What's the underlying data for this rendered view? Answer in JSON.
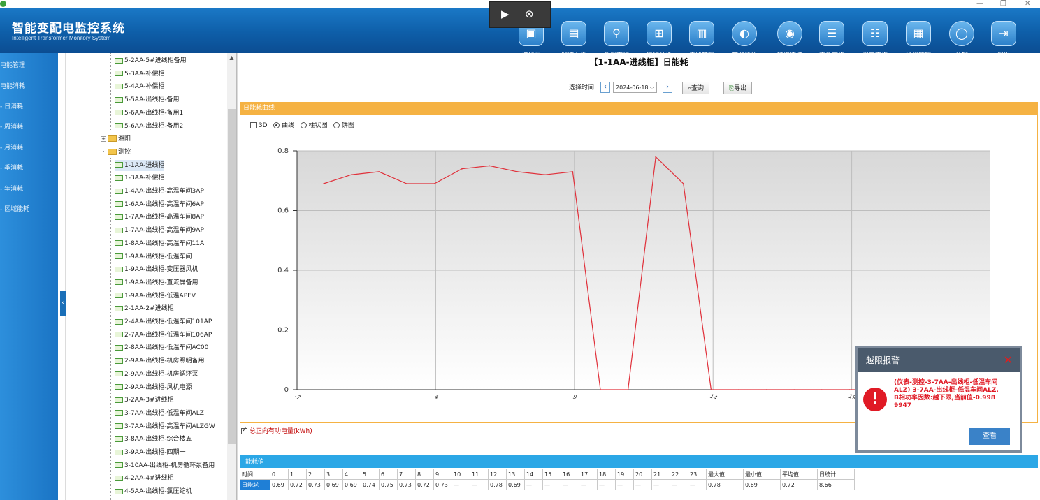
{
  "app": {
    "title": "智能变配电监控系统",
    "subtitle": "Intelligent Transformer Monitory System"
  },
  "window_controls": [
    "—",
    "❐",
    "✕"
  ],
  "nav": [
    {
      "label": "接线图",
      "icon": "monitor-icon"
    },
    {
      "label": "监控看板",
      "icon": "dashboard-icon"
    },
    {
      "label": "数据查询",
      "icon": "satellite-icon"
    },
    {
      "label": "运行分析",
      "icon": "network-icon"
    },
    {
      "label": "电能管理",
      "icon": "computer-icon"
    },
    {
      "label": "节能评估",
      "icon": "leaf-icon"
    },
    {
      "label": "环境监控",
      "icon": "camera-icon"
    },
    {
      "label": "事件查询",
      "icon": "list-icon"
    },
    {
      "label": "报表查询",
      "icon": "report-icon"
    },
    {
      "label": "通讯管理",
      "icon": "comm-icon"
    },
    {
      "label": "注销",
      "icon": "user-icon"
    },
    {
      "label": "退出",
      "icon": "exit-icon"
    }
  ],
  "left_menu": [
    "电能管理",
    "电能消耗",
    "- 日消耗",
    "- 周消耗",
    "- 月消耗",
    "- 季消耗",
    "- 年消耗",
    "- 区域能耗"
  ],
  "tree": [
    {
      "label": "5-2AA-5#进线柜备用",
      "type": "leaf"
    },
    {
      "label": "5-3AA-补偿柜",
      "type": "leaf"
    },
    {
      "label": "5-4AA-补偿柜",
      "type": "leaf"
    },
    {
      "label": "5-5AA-出线柜-备用",
      "type": "leaf"
    },
    {
      "label": "5-6AA-出线柜-备用1",
      "type": "leaf"
    },
    {
      "label": "5-6AA-出线柜-备用2",
      "type": "leaf"
    },
    {
      "label": "湘阳",
      "type": "folder",
      "exp": "+"
    },
    {
      "label": "测控",
      "type": "folder",
      "exp": "-"
    },
    {
      "label": "1-1AA-进线柜",
      "type": "leaf",
      "selected": true
    },
    {
      "label": "1-3AA-补偿柜",
      "type": "leaf"
    },
    {
      "label": "1-4AA-出线柜-高温车间3AP",
      "type": "leaf"
    },
    {
      "label": "1-6AA-出线柜-高温车间6AP",
      "type": "leaf"
    },
    {
      "label": "1-7AA-出线柜-高温车间8AP",
      "type": "leaf"
    },
    {
      "label": "1-7AA-出线柜-高温车间9AP",
      "type": "leaf"
    },
    {
      "label": "1-8AA-出线柜-高温车间11A",
      "type": "leaf"
    },
    {
      "label": "1-9AA-出线柜-低温车间",
      "type": "leaf"
    },
    {
      "label": "1-9AA-出线柜-变压器风机",
      "type": "leaf"
    },
    {
      "label": "1-9AA-出线柜-直流屏备用",
      "type": "leaf"
    },
    {
      "label": "1-9AA-出线柜-低温APEV",
      "type": "leaf"
    },
    {
      "label": "2-1AA-2#进线柜",
      "type": "leaf"
    },
    {
      "label": "2-4AA-出线柜-低温车间101AP",
      "type": "leaf"
    },
    {
      "label": "2-7AA-出线柜-低温车间106AP",
      "type": "leaf"
    },
    {
      "label": "2-8AA-出线柜-低温车间AC00",
      "type": "leaf"
    },
    {
      "label": "2-9AA-出线柜-机房照明备用",
      "type": "leaf"
    },
    {
      "label": "2-9AA-出线柜-机房循环泵",
      "type": "leaf"
    },
    {
      "label": "2-9AA-出线柜-风机电源",
      "type": "leaf"
    },
    {
      "label": "3-2AA-3#进线柜",
      "type": "leaf"
    },
    {
      "label": "3-7AA-出线柜-低温车间ALZ",
      "type": "leaf"
    },
    {
      "label": "3-7AA-出线柜-高温车间ALZGW",
      "type": "leaf"
    },
    {
      "label": "3-8AA-出线柜-综合楼五",
      "type": "leaf"
    },
    {
      "label": "3-9AA-出线柜-四期一",
      "type": "leaf"
    },
    {
      "label": "3-10AA-出线柜-机房循环泵备用",
      "type": "leaf"
    },
    {
      "label": "4-2AA-4#进线柜",
      "type": "leaf"
    },
    {
      "label": "4-5AA-出线柜-氯压缩机",
      "type": "leaf"
    }
  ],
  "main": {
    "title": "【1-1AA-进线柜】日能耗",
    "date_label": "选择时间:",
    "date_value": "2024-06-18",
    "query_label": "查询",
    "export_label": "导出",
    "panel_title": "日能耗曲线",
    "opt_3d": "3D",
    "opt_line": "曲线",
    "opt_bar": "柱状图",
    "opt_pie": "饼图",
    "legend_label": "总正向有功电量(kWh)",
    "energy_title": "能耗值"
  },
  "chart_data": {
    "type": "line",
    "x": [
      0,
      1,
      2,
      3,
      4,
      5,
      6,
      7,
      8,
      9,
      10,
      11,
      12,
      13,
      14,
      15,
      16,
      17,
      18,
      19,
      20,
      21,
      22,
      23
    ],
    "values": [
      0.69,
      0.72,
      0.73,
      0.69,
      0.69,
      0.74,
      0.75,
      0.73,
      0.72,
      0.73,
      0,
      0,
      0.78,
      0.69,
      0,
      0,
      0,
      0,
      0,
      0,
      0,
      0,
      0,
      0
    ],
    "series": [
      {
        "name": "总正向有功电量(kWh)",
        "color": "#e0303a"
      }
    ],
    "yticks": [
      "0",
      "0.2",
      "0.4",
      "0.6",
      "0.8"
    ],
    "xticks": [
      "-7",
      "4",
      "9",
      "14",
      "19"
    ],
    "ylim": [
      0,
      0.8
    ],
    "grid": true,
    "legend": "bottom-left"
  },
  "table": {
    "headers": [
      "时间",
      "0",
      "1",
      "2",
      "3",
      "4",
      "5",
      "6",
      "7",
      "8",
      "9",
      "10",
      "11",
      "12",
      "13",
      "14",
      "15",
      "16",
      "17",
      "18",
      "19",
      "20",
      "21",
      "22",
      "23",
      "最大值",
      "最小值",
      "平均值",
      "日统计"
    ],
    "rows": [
      [
        "日能耗",
        "0.69",
        "0.72",
        "0.73",
        "0.69",
        "0.69",
        "0.74",
        "0.75",
        "0.73",
        "0.72",
        "0.73",
        "—",
        "—",
        "0.78",
        "0.69",
        "—",
        "—",
        "—",
        "—",
        "—",
        "—",
        "—",
        "—",
        "—",
        "—",
        "0.78",
        "0.69",
        "0.72",
        "8.66"
      ]
    ]
  },
  "alarm": {
    "title": "越限报警",
    "message": "(仪表-测控-3-7AA-出线柜-低温车间ALZ) 3-7AA-出线柜-低温车间ALZ.B相功率因数:越下限,当前值-0.9989947",
    "button": "查看"
  }
}
